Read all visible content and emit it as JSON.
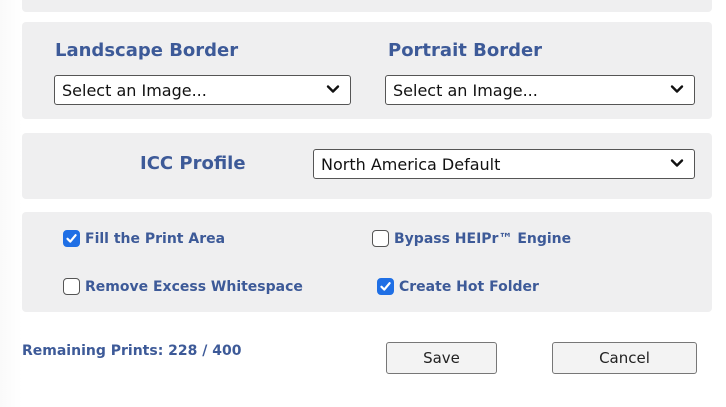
{
  "borders": {
    "landscape_label": "Landscape Border",
    "portrait_label": "Portrait Border",
    "landscape_value": "Select an Image...",
    "portrait_value": "Select an Image..."
  },
  "icc": {
    "label": "ICC Profile",
    "value": "North America Default"
  },
  "options": [
    {
      "label": "Fill the Print Area",
      "checked": true
    },
    {
      "label": "Bypass HEIPr™ Engine",
      "checked": false
    },
    {
      "label": "Remove Excess Whitespace",
      "checked": false
    },
    {
      "label": "Create Hot Folder",
      "checked": true
    }
  ],
  "footer": {
    "remaining": "Remaining Prints: 228 / 400",
    "save_label": "Save",
    "cancel_label": "Cancel"
  },
  "colors": {
    "accent": "#3d5a98",
    "checkbox_on": "#1f6fe5",
    "panel_bg": "#efeff0"
  },
  "icons": {
    "select_arrow": "chevron-down-icon",
    "checkbox_mark": "checkmark-icon"
  }
}
